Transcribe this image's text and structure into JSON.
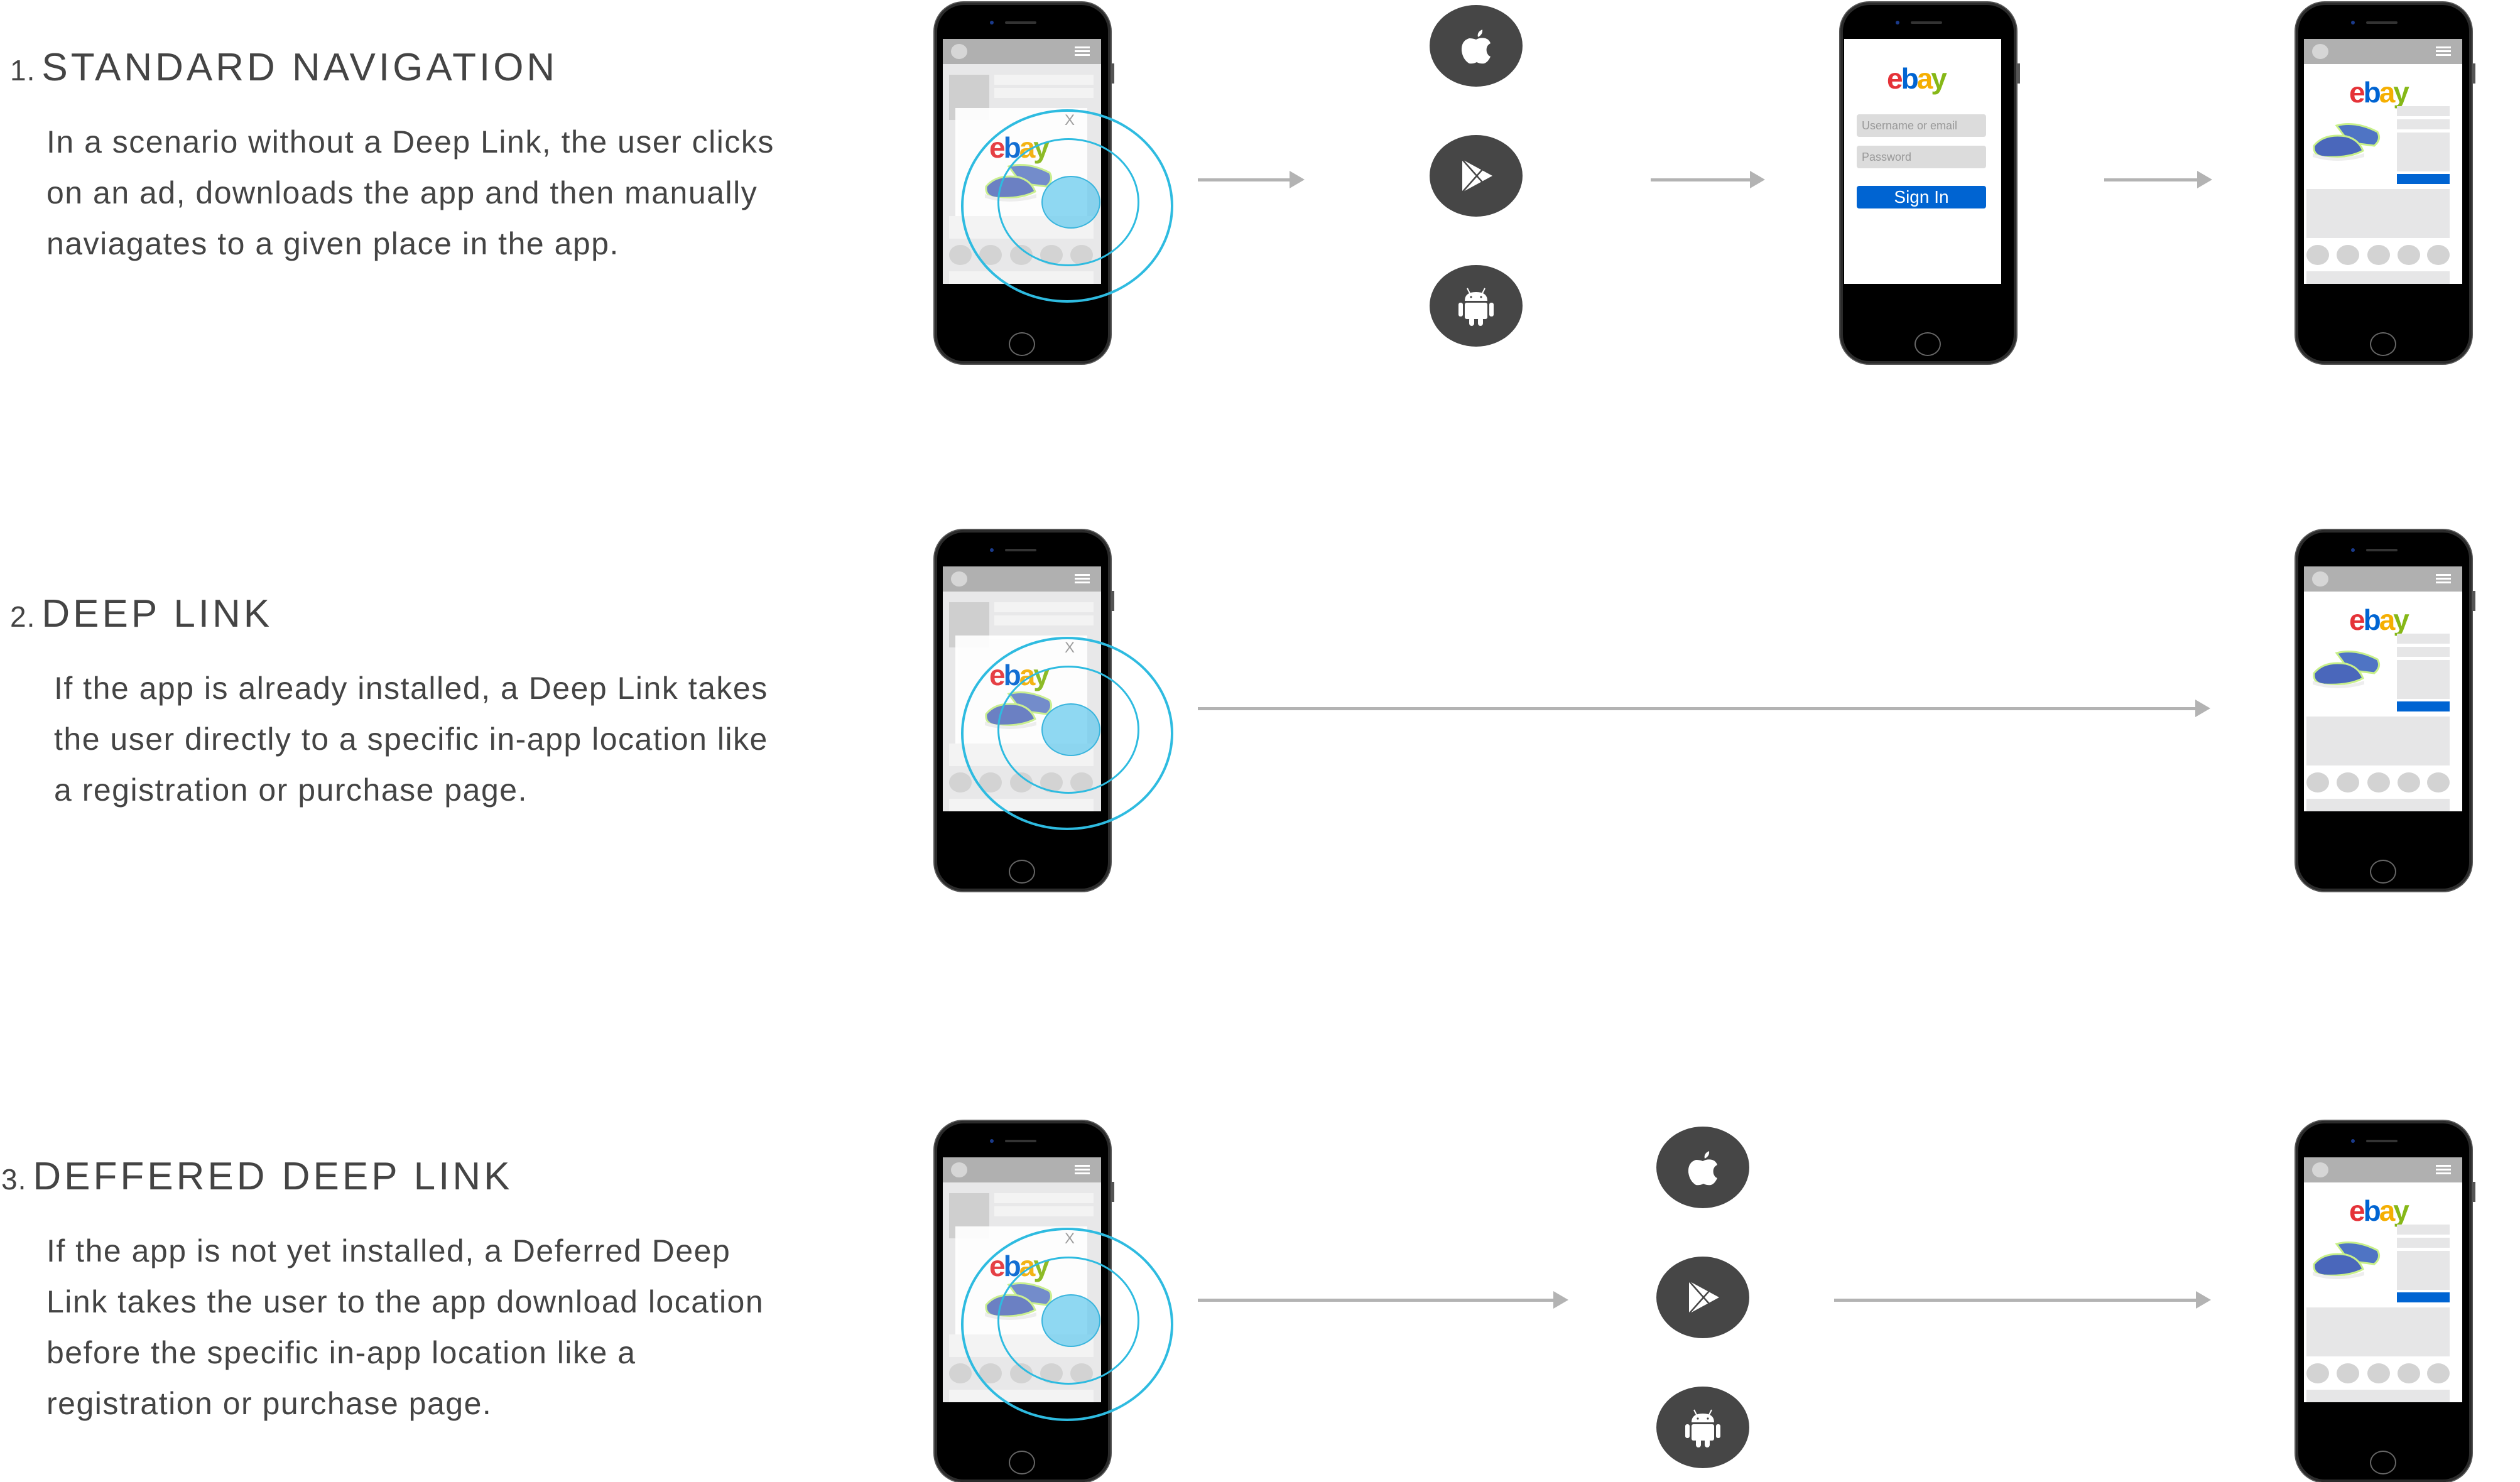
{
  "sections": [
    {
      "number": "1.",
      "title": "STANDARD NAVIGATION",
      "description": "In a scenario without a Deep Link, the user clicks\non an ad, downloads the app and then manually\nnaviagates to a given place in the app."
    },
    {
      "number": "2.",
      "title": "DEEP LINK",
      "description": "If the app is already installed, a Deep Link takes\nthe user directly to a specific in-app location like\na registration or purchase page."
    },
    {
      "number": "3.",
      "title": "DEFFERED DEEP LINK",
      "description": "If the app is not yet installed, a Deferred Deep\nLink takes the user to the app download location\nbefore the specific in-app location like a\nregistration or purchase page."
    }
  ],
  "ad_phone": {
    "logo": {
      "e": "e",
      "b": "b",
      "a": "a",
      "y": "y"
    },
    "close_label": "X"
  },
  "login_phone": {
    "logo": {
      "e": "e",
      "b": "b",
      "a": "a",
      "y": "y"
    },
    "username_placeholder": "Username or email",
    "password_placeholder": "Password",
    "sign_in_label": "Sign In"
  },
  "product_phone": {
    "logo": {
      "e": "e",
      "b": "b",
      "a": "a",
      "y": "y"
    }
  },
  "stores": [
    "apple-app-store",
    "google-play-store",
    "android"
  ],
  "colors": {
    "text": "#444444",
    "ripple": "#2ebbe0",
    "arrow": "#b3b3b3",
    "store_circle": "#464646",
    "sign_in_blue": "#0064d2",
    "ebay_red": "#e53238",
    "ebay_blue": "#0064d2",
    "ebay_yellow": "#f5af02",
    "ebay_green": "#86b817"
  }
}
